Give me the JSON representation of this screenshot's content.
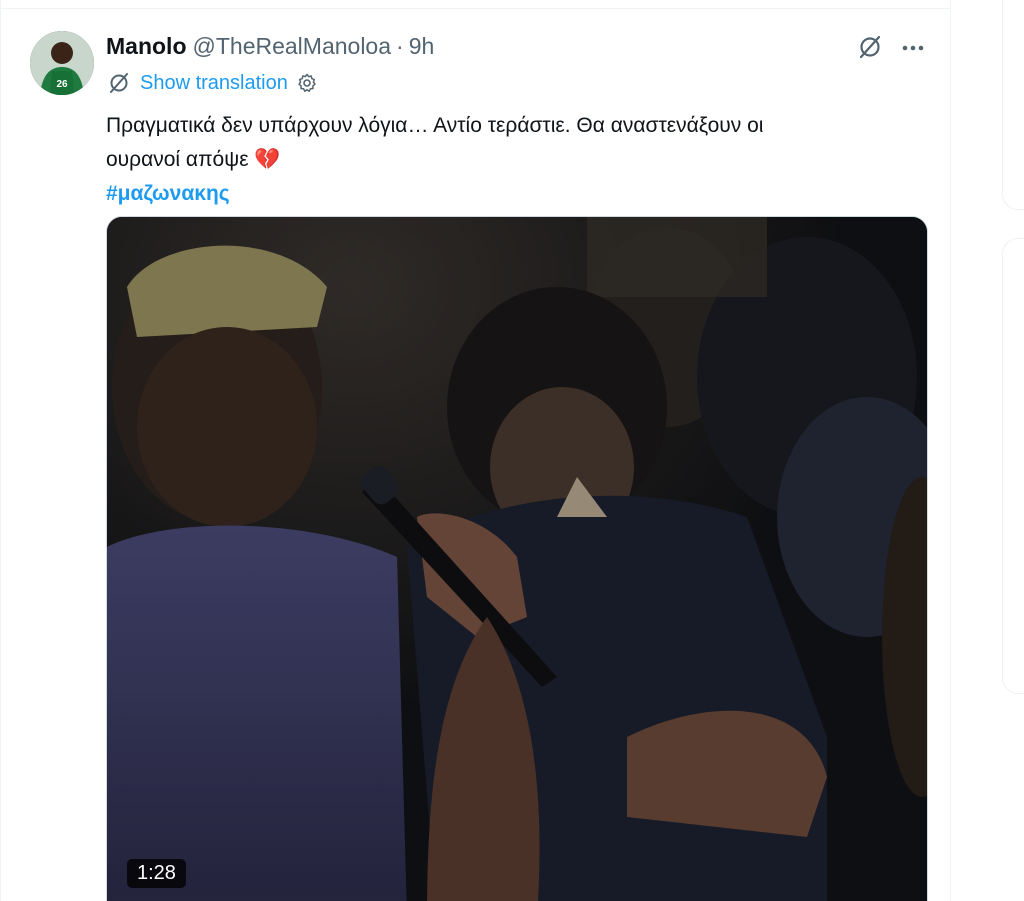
{
  "tweet": {
    "display_name": "Manolo",
    "handle": "@TheRealManoloa",
    "separator": "·",
    "time": "9h",
    "show_translation": "Show translation",
    "text_line1": "Πραγματικά δεν υπάρχουν λόγια… Αντίο τεράστιε. Θα αναστενάξουν οι",
    "text_line2": "ουρανοί απόψε",
    "emoji": "💔",
    "hashtag": "#μαζωνακης",
    "avatar_jersey_number": "26",
    "video_duration": "1:28"
  },
  "icons": {
    "grok": "grok-icon",
    "more": "more-icon",
    "translate": "translate-icon",
    "settings": "settings-icon"
  },
  "colors": {
    "accent": "#1d9bf0",
    "text": "#0f1419",
    "secondary": "#536471",
    "border": "#eff3f4"
  }
}
